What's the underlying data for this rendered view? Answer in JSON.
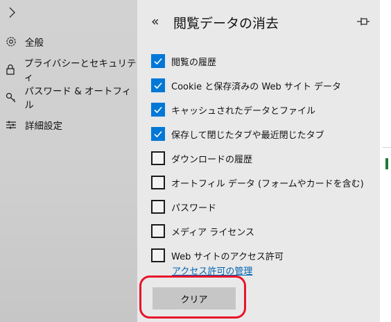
{
  "nav": {
    "items": [
      {
        "label": "全般",
        "icon": "gear-icon"
      },
      {
        "label": "プライバシーとセキュリティ",
        "icon": "lock-icon"
      },
      {
        "label": "パスワード & オートフィル",
        "icon": "key-icon"
      },
      {
        "label": "詳細設定",
        "icon": "sliders-icon"
      }
    ]
  },
  "panel": {
    "back_glyph": "«",
    "title": "閲覧データの消去",
    "items": [
      {
        "label": "閲覧の履歴",
        "checked": true
      },
      {
        "label": "Cookie と保存済みの Web サイト データ",
        "checked": true
      },
      {
        "label": "キャッシュされたデータとファイル",
        "checked": true
      },
      {
        "label": "保存して閉じたタブや最近閉じたタブ",
        "checked": true
      },
      {
        "label": "ダウンロードの履歴",
        "checked": false
      },
      {
        "label": "オートフィル データ (フォームやカードを含む)",
        "checked": false
      },
      {
        "label": "パスワード",
        "checked": false
      },
      {
        "label": "メディア ライセンス",
        "checked": false
      },
      {
        "label": "Web サイトのアクセス許可",
        "checked": false
      }
    ],
    "permissions_link": "アクセス許可の管理",
    "clear_button": "クリア"
  },
  "colors": {
    "checkbox_accent": "#0078d7",
    "link": "#0063b1",
    "highlight": "#e8132a"
  }
}
